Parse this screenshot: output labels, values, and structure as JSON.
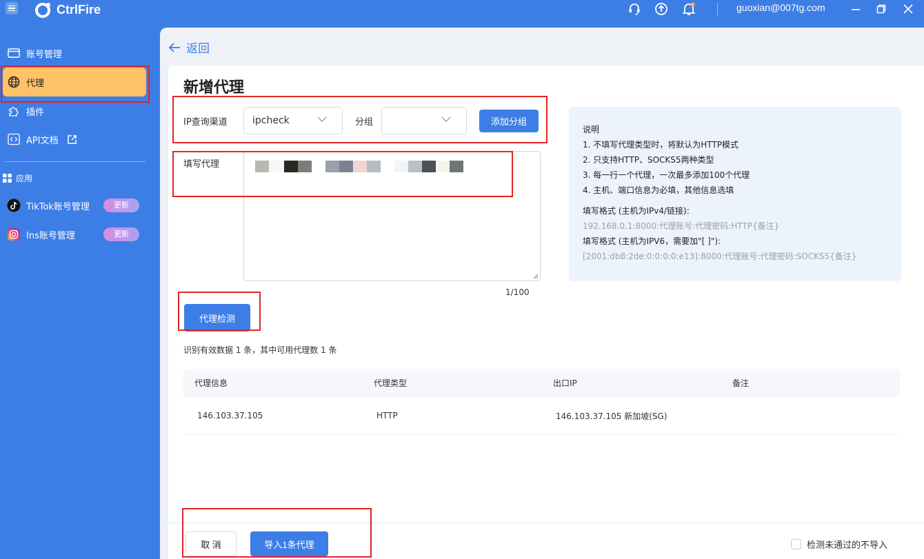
{
  "app": {
    "name": "CtrlFire",
    "user_email": "guoxian@007tg.com"
  },
  "colors": {
    "primary": "#3d7ee6",
    "active_nav": "#ffc266",
    "highlight": "#e02424",
    "badge_gradient_start": "#d98be0",
    "badge_gradient_end": "#a7a3f3"
  },
  "sidebar": {
    "items": [
      {
        "label": "账号管理",
        "icon": "browser-window-icon"
      },
      {
        "label": "代理",
        "icon": "globe-icon",
        "active": true
      },
      {
        "label": "插件",
        "icon": "puzzle-icon"
      },
      {
        "label": "API文档",
        "icon": "code-icon",
        "trailing_icon": "external-link-icon"
      }
    ],
    "section_label": "应用",
    "apps": [
      {
        "label": "TikTok账号管理",
        "icon": "tiktok-icon",
        "badge": "更新"
      },
      {
        "label": "Ins账号管理",
        "icon": "instagram-icon",
        "badge": "更新"
      }
    ]
  },
  "header": {
    "back_label": "返回",
    "title": "新增代理"
  },
  "form": {
    "ip_channel_label": "IP查询渠道",
    "ip_channel_value": "ipcheck",
    "group_label": "分组",
    "group_value": "",
    "add_group_label": "添加分组",
    "proxy_input_label": "填写代理",
    "counter": "1/100",
    "check_button_label": "代理检测"
  },
  "info": {
    "heading": "说明",
    "lines": [
      "1. 不填写代理类型时，将默认为HTTP模式",
      "2. 只支持HTTP、SOCKS5两种类型",
      "3. 每一行一个代理，一次最多添加100个代理",
      "4. 主机、端口信息为必填，其他信息选填"
    ],
    "format_ipv4_label": "填写格式 (主机为IPv4/链接):",
    "format_ipv4_example": "192.168.0.1:8000:代理账号:代理密码:HTTP{备注}",
    "format_ipv6_label": "填写格式 (主机为IPV6，需要加\"[ ]\"):",
    "format_ipv6_example": "[2001:db8:2de:0:0:0:0:e13]:8000:代理账号:代理密码:SOCKS5{备注}"
  },
  "result": {
    "summary": "识别有效数据 1 条，其中可用代理数 1 条",
    "columns": [
      "代理信息",
      "代理类型",
      "出口IP",
      "备注"
    ],
    "rows": [
      {
        "info": "146.103.37.105",
        "type": "HTTP",
        "exit_ip": "146.103.37.105 新加坡(SG)",
        "note": ""
      }
    ]
  },
  "footer": {
    "cancel_label": "取 消",
    "import_label": "导入1条代理",
    "skip_failed_label": "检测未通过的不导入",
    "skip_failed_checked": false
  }
}
